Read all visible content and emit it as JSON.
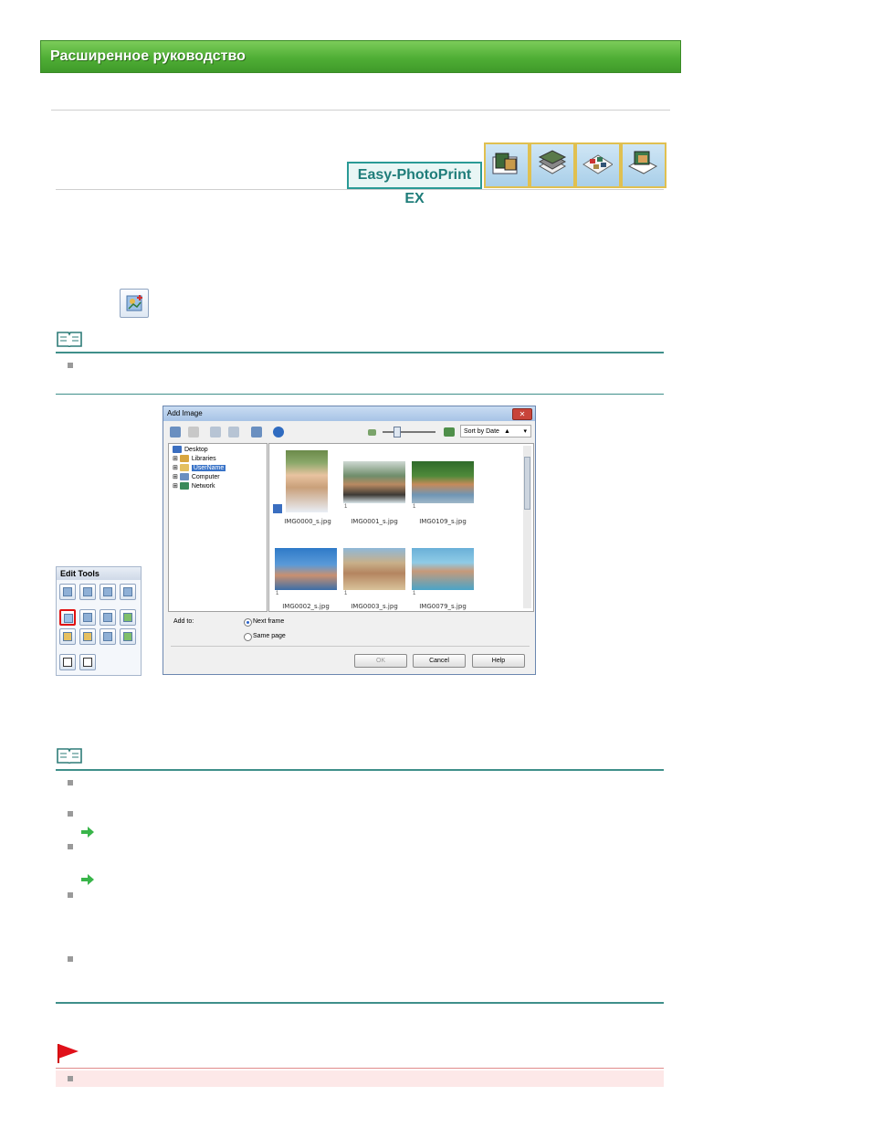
{
  "header": {
    "title": "Расширенное руководство"
  },
  "product": {
    "brand_label": "Easy-PhotoPrint EX",
    "tiles": [
      "album-icon",
      "stacked-photos-icon",
      "layout-print-icon",
      "calendar-icon"
    ]
  },
  "edit_tools": {
    "title": "Edit  Tools",
    "rows": [
      [
        "layer-up-icon",
        "layer-down-icon",
        "bring-front-icon",
        "send-back-icon"
      ],
      [
        "add-image-icon",
        "swap-icon",
        "replace-icon",
        "background-icon"
      ],
      [
        "crop-icon",
        "frame-icon",
        "rotate-icon",
        "effect-icon"
      ],
      [
        "text-icon",
        "text-vertical-icon"
      ]
    ],
    "selected_index": 4
  },
  "dialog": {
    "title": "Add Image",
    "close_label": "✕",
    "sort_label": "Sort by Date",
    "tree": [
      {
        "label": "Desktop"
      },
      {
        "label": "Libraries"
      },
      {
        "label": "UserName",
        "selected": true
      },
      {
        "label": "Computer"
      },
      {
        "label": "Network"
      }
    ],
    "images": [
      {
        "name": "IMG0000_s.jpg",
        "count": ""
      },
      {
        "name": "IMG0001_s.jpg",
        "count": "1"
      },
      {
        "name": "IMG0109_s.jpg",
        "count": "1"
      },
      {
        "name": "IMG0002_s.jpg",
        "count": "1"
      },
      {
        "name": "IMG0003_s.jpg",
        "count": "1"
      },
      {
        "name": "IMG0079_s.jpg",
        "count": "1"
      }
    ],
    "add_to_label": "Add to:",
    "options": [
      {
        "label": "Next frame",
        "selected": true
      },
      {
        "label": "Same page",
        "selected": false
      }
    ],
    "buttons": {
      "ok": "OK",
      "cancel": "Cancel",
      "help": "Help"
    }
  },
  "colors": {
    "header_green": "#4fae35",
    "teal_rule": "#3f8f8a",
    "important_band": "#fde8e8",
    "important_flag": "#e0101a"
  }
}
